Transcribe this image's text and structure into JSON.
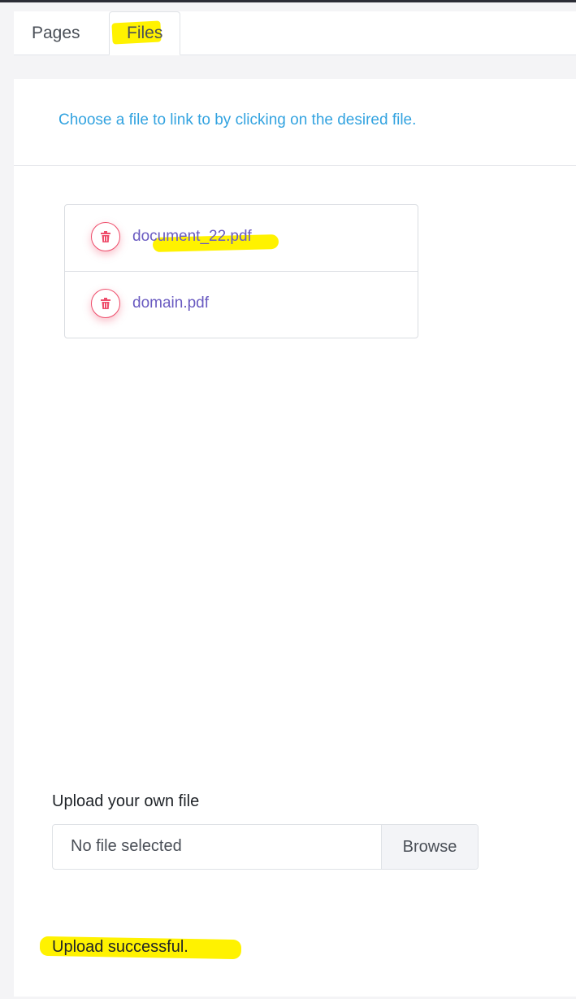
{
  "tabs": [
    {
      "label": "Pages",
      "active": false
    },
    {
      "label": "Files",
      "active": true
    }
  ],
  "hint": "Choose a file to link to by clicking on the desired file.",
  "files": [
    {
      "name": "document_22.pdf",
      "delete_icon": "trash-icon"
    },
    {
      "name": "domain.pdf",
      "delete_icon": "trash-icon"
    }
  ],
  "upload": {
    "label": "Upload your own file",
    "field_text": "No file selected",
    "button_label": "Browse"
  },
  "status": "Upload successful.",
  "colors": {
    "accent_link": "#6a5bc1",
    "hint_blue": "#33a3e0",
    "delete_red": "#ee4d6b",
    "highlight_yellow": "#fff200"
  }
}
